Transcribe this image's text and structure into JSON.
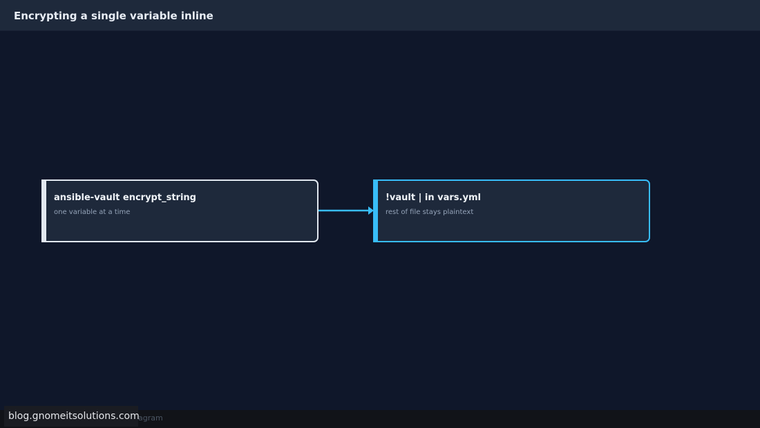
{
  "header": {
    "title": "Encrypting a single variable inline"
  },
  "diagram": {
    "nodes": [
      {
        "id": "a",
        "label": "ansible-vault encrypt_string",
        "sublabel": "one variable at a time",
        "accent": "#e2e8f0"
      },
      {
        "id": "b",
        "label": "!vault | in vars.yml",
        "sublabel": "rest of file stays plaintext",
        "accent": "#38bdf8"
      }
    ],
    "edges": [
      {
        "from": "a",
        "to": "b",
        "color": "#38bdf8"
      }
    ]
  },
  "footer": {
    "caption": "agram",
    "watermark": "blog.gnomeitsolutions.com"
  }
}
